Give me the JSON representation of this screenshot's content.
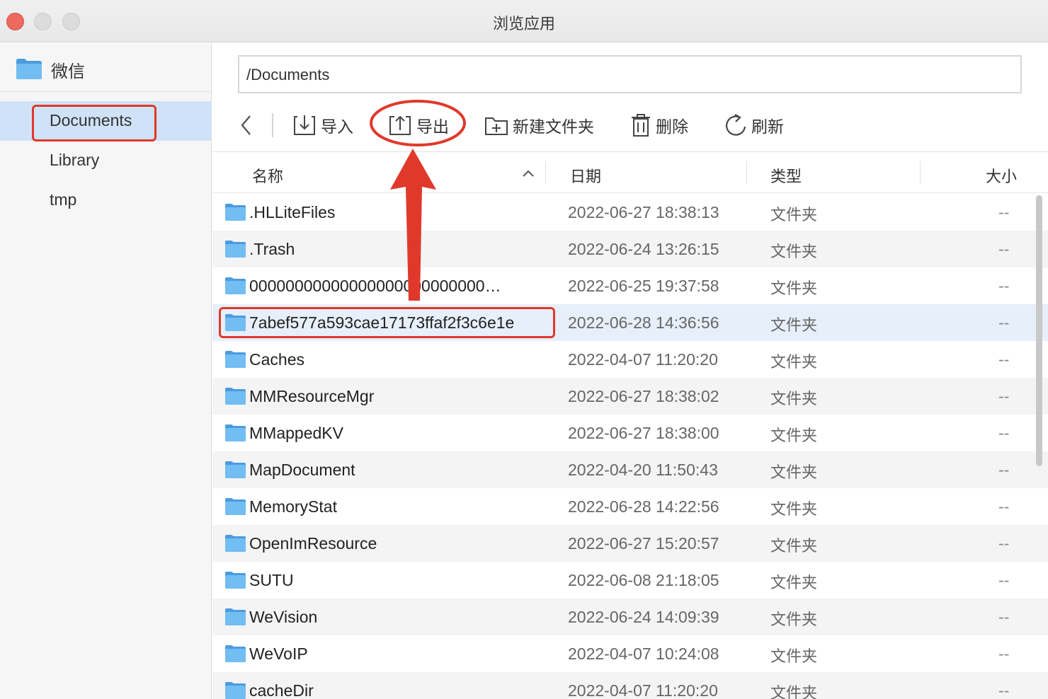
{
  "window": {
    "title": "浏览应用"
  },
  "sidebar": {
    "app": {
      "name": "微信",
      "icon": "folder-icon"
    },
    "items": [
      {
        "label": "Documents",
        "active": true
      },
      {
        "label": "Library",
        "active": false
      },
      {
        "label": "tmp",
        "active": false
      }
    ]
  },
  "path": {
    "value": "/Documents"
  },
  "toolbar": {
    "back_icon": "chevron-left-icon",
    "import_label": "导入",
    "export_label": "导出",
    "new_folder_label": "新建文件夹",
    "delete_label": "删除",
    "refresh_label": "刷新"
  },
  "table": {
    "columns": {
      "name": "名称",
      "date": "日期",
      "type": "类型",
      "size": "大小"
    },
    "sort_icon": "chevron-up-icon",
    "rows": [
      {
        "name": ".HLLiteFiles",
        "date": "2022-06-27 18:38:13",
        "type": "文件夹",
        "size": "--"
      },
      {
        "name": ".Trash",
        "date": "2022-06-24 13:26:15",
        "type": "文件夹",
        "size": "--"
      },
      {
        "name": "00000000000000000000000000…",
        "date": "2022-06-25 19:37:58",
        "type": "文件夹",
        "size": "--"
      },
      {
        "name": "7abef577a593cae17173ffaf2f3c6e1e",
        "date": "2022-06-28 14:36:56",
        "type": "文件夹",
        "size": "--"
      },
      {
        "name": "Caches",
        "date": "2022-04-07 11:20:20",
        "type": "文件夹",
        "size": "--"
      },
      {
        "name": "MMResourceMgr",
        "date": "2022-06-27 18:38:02",
        "type": "文件夹",
        "size": "--"
      },
      {
        "name": "MMappedKV",
        "date": "2022-06-27 18:38:00",
        "type": "文件夹",
        "size": "--"
      },
      {
        "name": "MapDocument",
        "date": "2022-04-20 11:50:43",
        "type": "文件夹",
        "size": "--"
      },
      {
        "name": "MemoryStat",
        "date": "2022-06-28 14:22:56",
        "type": "文件夹",
        "size": "--"
      },
      {
        "name": "OpenImResource",
        "date": "2022-06-27 15:20:57",
        "type": "文件夹",
        "size": "--"
      },
      {
        "name": "SUTU",
        "date": "2022-06-08 21:18:05",
        "type": "文件夹",
        "size": "--"
      },
      {
        "name": "WeVision",
        "date": "2022-06-24 14:09:39",
        "type": "文件夹",
        "size": "--"
      },
      {
        "name": "WeVoIP",
        "date": "2022-04-07 10:24:08",
        "type": "文件夹",
        "size": "--"
      },
      {
        "name": "cacheDir",
        "date": "2022-04-07 11:20:20",
        "type": "文件夹",
        "size": "--"
      }
    ]
  },
  "colors": {
    "annotation": "#e0392b",
    "selection": "#cfe2f8",
    "folder": "#5aa9e6"
  }
}
